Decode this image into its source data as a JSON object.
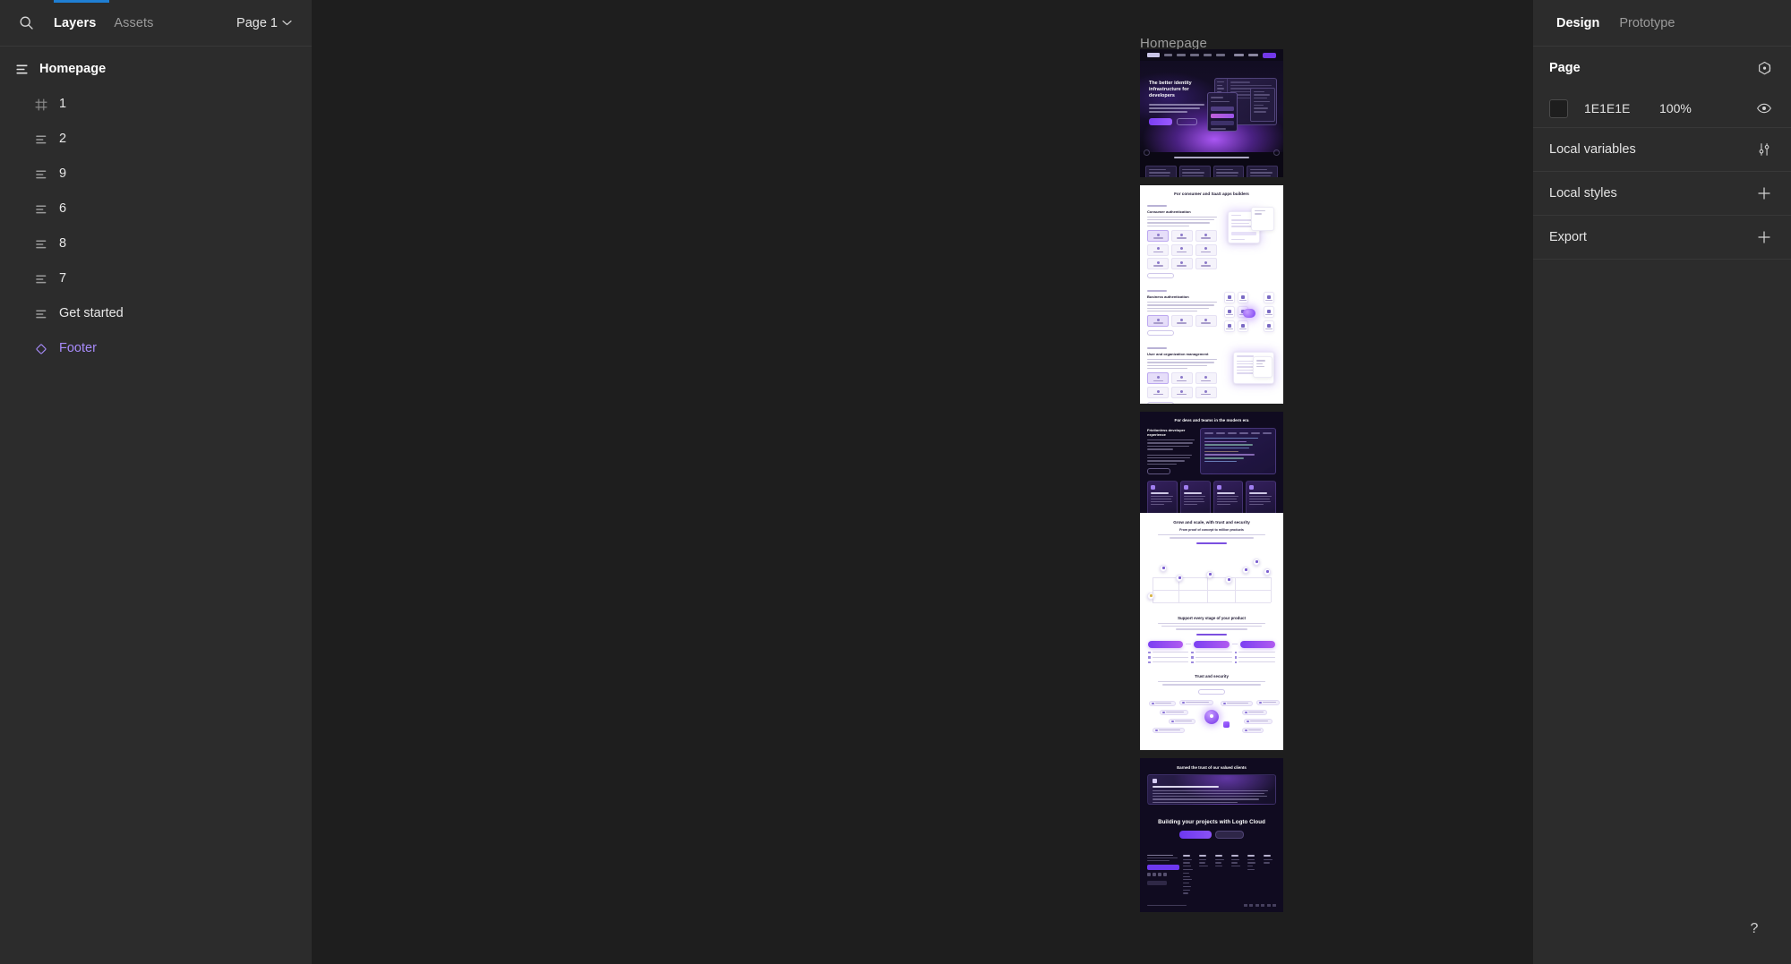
{
  "app": {
    "background": "#1e1e1e",
    "panel_bg": "#2c2c2c",
    "accent_blue": "#1f7fd4",
    "component_purple": "#a78bfa"
  },
  "left_panel": {
    "search_icon": "search-icon",
    "tabs": [
      {
        "label": "Layers",
        "active": true
      },
      {
        "label": "Assets",
        "active": false
      }
    ],
    "page_selector": {
      "label": "Page 1",
      "chevron_icon": "chevron-down-icon"
    },
    "layers": [
      {
        "name": "Homepage",
        "icon": "autolayout-icon",
        "depth": 0,
        "bold": true,
        "component": false
      },
      {
        "name": "1",
        "icon": "grid-frame-icon",
        "depth": 1,
        "bold": false,
        "component": false
      },
      {
        "name": "2",
        "icon": "autolayout-icon",
        "depth": 1,
        "bold": false,
        "component": false
      },
      {
        "name": "9",
        "icon": "autolayout-icon",
        "depth": 1,
        "bold": false,
        "component": false
      },
      {
        "name": "6",
        "icon": "autolayout-icon",
        "depth": 1,
        "bold": false,
        "component": false
      },
      {
        "name": "8",
        "icon": "autolayout-icon",
        "depth": 1,
        "bold": false,
        "component": false
      },
      {
        "name": "7",
        "icon": "autolayout-icon",
        "depth": 1,
        "bold": false,
        "component": false
      },
      {
        "name": "Get started",
        "icon": "autolayout-icon",
        "depth": 1,
        "bold": false,
        "component": false
      },
      {
        "name": "Footer",
        "icon": "component-instance-icon",
        "depth": 1,
        "bold": false,
        "component": true
      }
    ]
  },
  "canvas": {
    "frame_label": "Homepage",
    "frames": [
      {
        "id": "hero",
        "hero_heading": "The better identity infrastructure for developers",
        "sub_strip": "Logto is endorsed by many developers and businesses"
      },
      {
        "id": "consumer-saas",
        "title": "For consumer and SaaS apps builders",
        "blocks": [
          {
            "heading": "Consumer authentication"
          },
          {
            "heading": "Business authentication"
          },
          {
            "heading": "User and organization management"
          }
        ]
      },
      {
        "id": "devs-teams",
        "title": "For devs and teams in the modern era",
        "heading": "Frictionless developer experience"
      },
      {
        "id": "grow-scale",
        "title": "Grow and scale, with trust and security",
        "subtitle": "From proof of concept to million products",
        "step_title": "Support every stage of your product",
        "trust_title": "Trust and security"
      },
      {
        "id": "clients-cta",
        "title": "Earned the trust of our valued clients",
        "cta_title": "Building your projects with Logto Cloud"
      }
    ]
  },
  "right_panel": {
    "tabs": [
      {
        "label": "Design",
        "active": true
      },
      {
        "label": "Prototype",
        "active": false
      }
    ],
    "sections": [
      {
        "title": "Page",
        "bold": true,
        "action_icon": "page-settings-icon"
      },
      {
        "title": "Local variables",
        "bold": false,
        "action_icon": "variables-sliders-icon"
      },
      {
        "title": "Local styles",
        "bold": false,
        "action_icon": "plus-icon"
      },
      {
        "title": "Export",
        "bold": false,
        "action_icon": "plus-icon"
      }
    ],
    "page_fill": {
      "hex": "1E1E1E",
      "opacity": "100%",
      "swatch_color": "#1E1E1E",
      "visibility_icon": "eye-icon"
    }
  },
  "help_button": {
    "label": "?"
  },
  "progress": {
    "value": 0.03
  }
}
